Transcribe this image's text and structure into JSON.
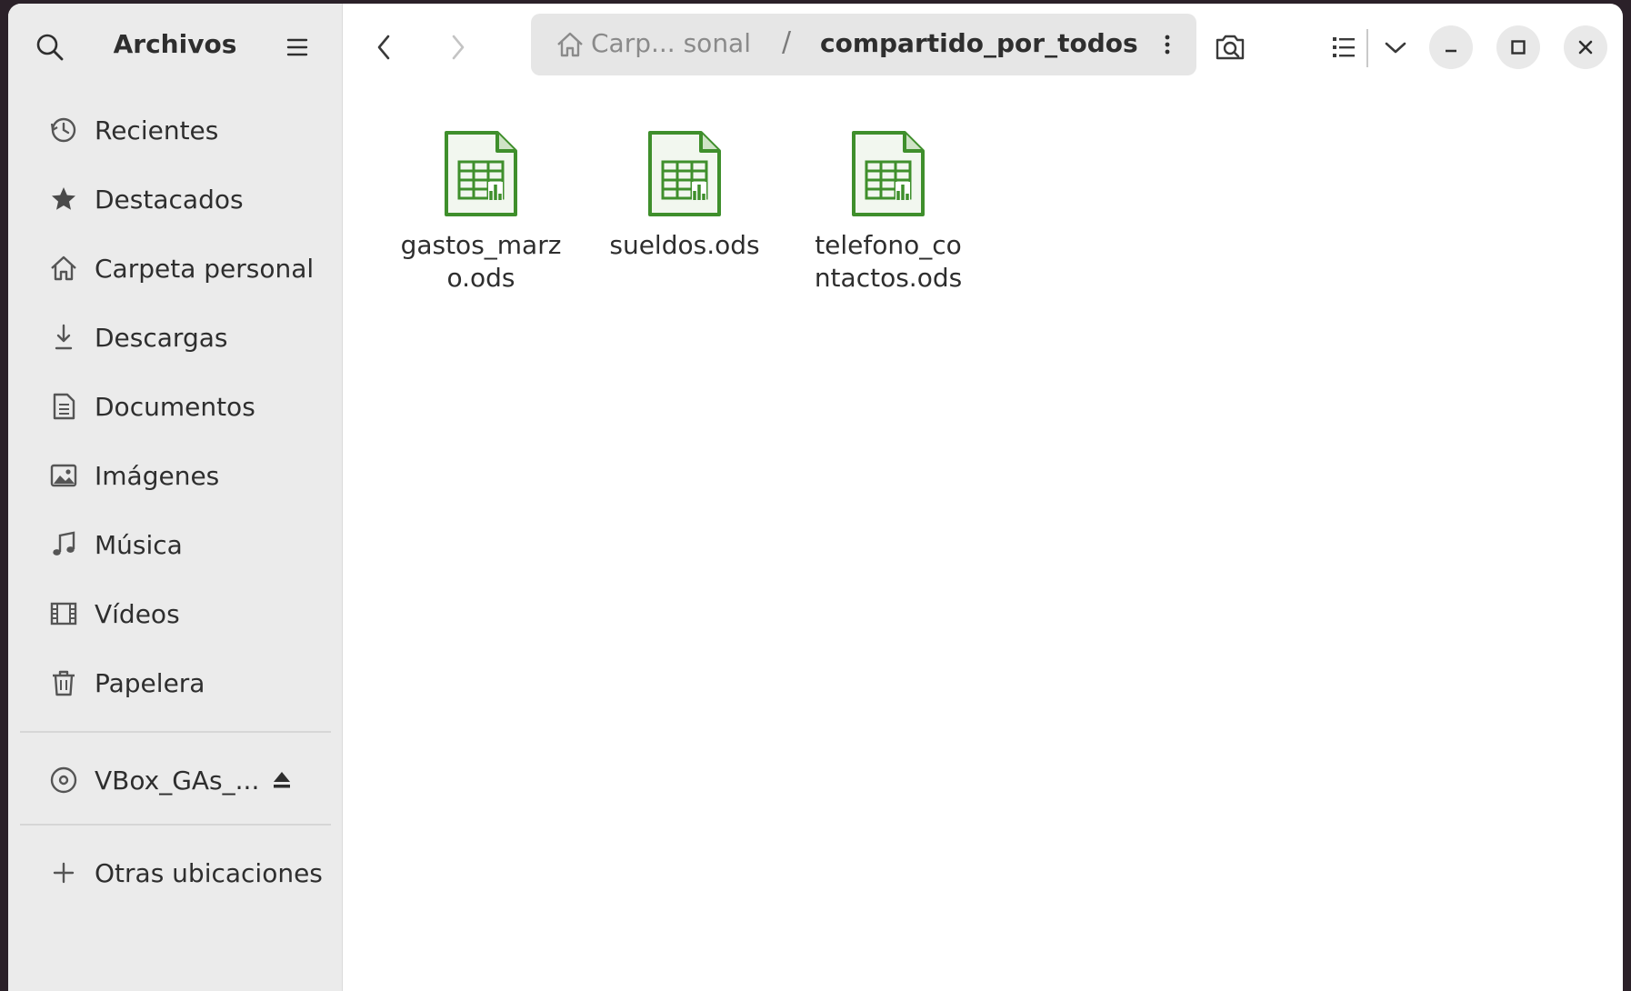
{
  "app": {
    "title": "Archivos"
  },
  "sidebar": {
    "search_icon": "search-icon",
    "menu_icon": "hamburger-menu-icon",
    "items": [
      {
        "label": "Recientes",
        "icon": "clock-icon"
      },
      {
        "label": "Destacados",
        "icon": "star-icon"
      },
      {
        "label": "Carpeta personal",
        "icon": "home-icon"
      },
      {
        "label": "Descargas",
        "icon": "download-icon"
      },
      {
        "label": "Documentos",
        "icon": "document-icon"
      },
      {
        "label": "Imágenes",
        "icon": "image-icon"
      },
      {
        "label": "Música",
        "icon": "music-icon"
      },
      {
        "label": "Vídeos",
        "icon": "video-icon"
      },
      {
        "label": "Papelera",
        "icon": "trash-icon"
      }
    ],
    "devices": [
      {
        "label": "VBox_GAs_...",
        "icon": "disc-icon",
        "action_icon": "eject-icon"
      }
    ],
    "other_locations": {
      "label": "Otras ubicaciones",
      "icon": "plus-icon"
    }
  },
  "header": {
    "back_icon": "chevron-left-icon",
    "forward_icon": "chevron-right-icon",
    "path": {
      "home_icon": "home-icon",
      "parent": "Carp... sonal",
      "separator": "/",
      "current": "compartido_por_todos",
      "more_icon": "kebab-menu-icon"
    },
    "search_folder_icon": "folder-search-icon",
    "view_icon": "list-view-icon",
    "view_options_icon": "chevron-down-icon",
    "window_controls": [
      "minimize-icon",
      "maximize-icon",
      "close-icon"
    ]
  },
  "files": [
    {
      "name": "gastos_marzo.ods",
      "display": "gastos_marz\no.ods",
      "icon": "spreadsheet-file-icon"
    },
    {
      "name": "sueldos.ods",
      "display": "sueldos.ods",
      "icon": "spreadsheet-file-icon"
    },
    {
      "name": "telefono_contactos.ods",
      "display": "telefono_co\nntactos.ods",
      "icon": "spreadsheet-file-icon"
    }
  ],
  "colors": {
    "sidebar_bg": "#ebebeb",
    "content_bg": "#ffffff",
    "spreadsheet_green": "#3f8f2c",
    "pathbar_bg": "#e6e6e6"
  }
}
